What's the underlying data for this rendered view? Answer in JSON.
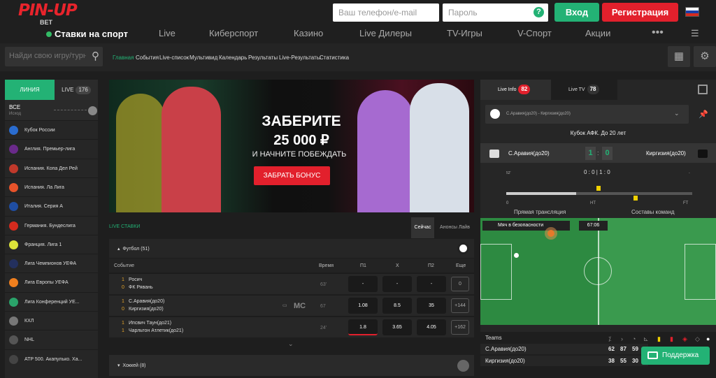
{
  "brand": {
    "logo": "PIN-UP",
    "logo_sub": "BET",
    "tag": "Ставки на спорт"
  },
  "auth": {
    "phone_placeholder": "Ваш телефон/e-mail",
    "password_placeholder": "Пароль",
    "help": "?",
    "login": "Вход",
    "register": "Регистрация"
  },
  "nav": [
    "Live",
    "Киберспорт",
    "Казино",
    "Live Дилеры",
    "TV-Игры",
    "V-Спорт",
    "Акции"
  ],
  "nav_more": "•••",
  "search": {
    "placeholder": "Найди свою игру/турнир"
  },
  "subnav": [
    "Главная",
    "События",
    "Live-список",
    "Мультивид",
    "Календарь",
    "Результаты",
    "Live-Результаты",
    "Статистика"
  ],
  "left": {
    "tab_line": "ЛИНИЯ",
    "tab_live": "LIVE",
    "live_count": "176",
    "all_label": "ВСЕ",
    "all_sub": "Исход",
    "leagues": [
      {
        "name": "Кубок России",
        "color": "#2a6ccf"
      },
      {
        "name": "Англия. Премьер-лига",
        "color": "#6a2a8a"
      },
      {
        "name": "Испания. Копа Дел Рей",
        "color": "#c0392b"
      },
      {
        "name": "Испания. Ла Лига",
        "color": "#e8532a"
      },
      {
        "name": "Италия. Серия А",
        "color": "#1f4ea3"
      },
      {
        "name": "Германия. Бундеслига",
        "color": "#d52b1e"
      },
      {
        "name": "Франция. Лига 1",
        "color": "#dce33a"
      },
      {
        "name": "Лига Чемпионов УЕФА",
        "color": "#23305e"
      },
      {
        "name": "Лига Европы УЕФА",
        "color": "#f07f1e"
      },
      {
        "name": "Лига Конференций УЕ...",
        "color": "#2aa36a"
      },
      {
        "name": "КХЛ",
        "color": "#777"
      },
      {
        "name": "NHL",
        "color": "#555"
      },
      {
        "name": "ATP 500. Акапулько. Ха...",
        "color": "#444"
      }
    ]
  },
  "banner": {
    "line1": "ЗАБЕРИТЕ",
    "line2": "25 000 ₽",
    "line3": "И НАЧНИТЕ ПОБЕЖДАТЬ",
    "button": "ЗАБРАТЬ БОНУС"
  },
  "live": {
    "title": "LIVE СТАВКИ",
    "tab_now": "Сейчас",
    "tab_ann": "Анонсы Лайв",
    "section": "Футбол",
    "section_count": "(51)",
    "headers": {
      "event": "Событие",
      "time": "Время",
      "p1": "П1",
      "x": "X",
      "p2": "П2",
      "more": "Еще"
    },
    "matches": [
      {
        "s1": "1",
        "t1": "Росич",
        "s2": "0",
        "t2": "ФК Рявань",
        "time": "63'",
        "o1": "-",
        "ox": "-",
        "o2": "-",
        "more": "0"
      },
      {
        "s1": "1",
        "t1": "С.Аравия(до20)",
        "s2": "0",
        "t2": "Киргизия(до20)",
        "time": "67",
        "o1": "1.08",
        "ox": "8.5",
        "o2": "35",
        "more": "+144",
        "tag": "MC"
      },
      {
        "s1": "1",
        "t1": "Ипсвич Таун(до21)",
        "s2": "1",
        "t2": "Чарльтон Атлетик(до21)",
        "time": "24'",
        "o1": "1.8",
        "ox": "3.65",
        "o2": "4.05",
        "more": "+162"
      }
    ],
    "hockey": "Хоккей",
    "hockey_count": "(8)"
  },
  "right": {
    "tab_info": "Live Info",
    "info_count": "82",
    "tab_tv": "Live TV",
    "tv_count": "78",
    "match_select": "С.Аравия(до20) - Киргизия(до20)",
    "cup": "Кубок АФК. До 20 лет",
    "home": "С.Аравия(до20)",
    "away": "Киргизия(до20)",
    "score_home": "1",
    "score_away": "0",
    "minute": "52'",
    "periods": "0 : 0 | 1 : 0",
    "dash": "-",
    "tl_0": "0",
    "tl_ht": "HT",
    "tl_ft": "FT",
    "broadcast": "Прямая трансляция",
    "lineups": "Составы команд",
    "pitch_event": "Мяч в безопасности",
    "pitch_time": "67:06",
    "stats_title": "Teams",
    "stats": [
      {
        "team": "С.Аравия(до20)",
        "a": "62",
        "b": "87",
        "c": "59"
      },
      {
        "team": "Киргизия(до20)",
        "a": "38",
        "b": "55",
        "c": "30"
      }
    ],
    "support": "Поддержка"
  }
}
